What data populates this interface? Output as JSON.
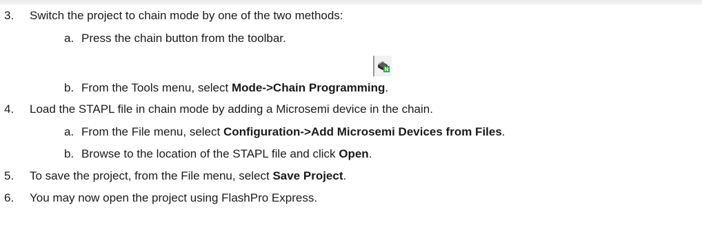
{
  "steps": [
    {
      "number": "3.",
      "text": "Switch the project to chain mode by one of the two methods:",
      "substeps": [
        {
          "letter": "a.",
          "text": "Press the chain button from the toolbar."
        },
        {
          "letter": "b.",
          "prefix": "From the Tools menu, select ",
          "bold": "Mode->Chain Programming",
          "suffix": "."
        }
      ]
    },
    {
      "number": "4.",
      "text": "Load the STAPL file in chain mode by adding a Microsemi device in the chain.",
      "substeps": [
        {
          "letter": "a.",
          "prefix": "From the File menu, select ",
          "bold": "Configuration->Add Microsemi Devices from Files",
          "suffix": "."
        },
        {
          "letter": "b.",
          "prefix": "Browse to the location of the STAPL file and click ",
          "bold": "Open",
          "suffix": "."
        }
      ]
    },
    {
      "number": "5.",
      "prefix": "To save the project, from the File menu, select ",
      "bold": "Save Project",
      "suffix": "."
    },
    {
      "number": "6.",
      "text": "You may now open the project using FlashPro Express."
    }
  ],
  "toolbar_icon": {
    "name": "chain-programming-icon",
    "badge": "N",
    "badge_color": "#1e9a3a",
    "chip_color": "#2b2b2b"
  }
}
